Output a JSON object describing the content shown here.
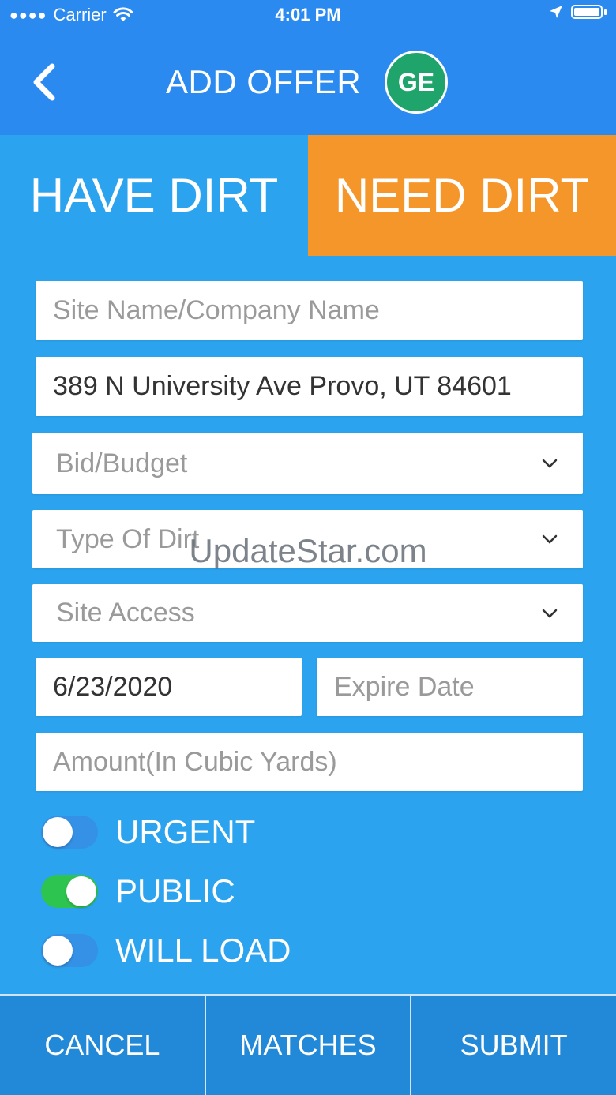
{
  "status_bar": {
    "carrier": "Carrier",
    "time": "4:01 PM"
  },
  "header": {
    "title": "ADD OFFER",
    "avatar_initials": "GE"
  },
  "tabs": [
    {
      "label": "HAVE DIRT",
      "selected": false
    },
    {
      "label": "NEED DIRT",
      "selected": true
    }
  ],
  "form": {
    "site_name": {
      "value": "",
      "placeholder": "Site Name/Company Name"
    },
    "address": {
      "value": "389 N University Ave Provo, UT 84601",
      "placeholder": ""
    },
    "bid_budget": {
      "placeholder": "Bid/Budget"
    },
    "dirt_type": {
      "placeholder": "Type Of Dirt"
    },
    "site_access": {
      "placeholder": "Site Access"
    },
    "start_date": {
      "value": "6/23/2020",
      "placeholder": ""
    },
    "expire_date": {
      "value": "",
      "placeholder": "Expire Date"
    },
    "amount": {
      "value": "",
      "placeholder": "Amount(In Cubic Yards)"
    }
  },
  "toggles": [
    {
      "label": "URGENT",
      "on": false
    },
    {
      "label": "PUBLIC",
      "on": true
    },
    {
      "label": "WILL LOAD",
      "on": false
    }
  ],
  "bottom_bar": {
    "cancel": "CANCEL",
    "matches": "MATCHES",
    "submit": "SUBMIT"
  },
  "watermark": "UpdateStar.com",
  "colors": {
    "header": "#2B8AF0",
    "background": "#2BA3EE",
    "selected_tab": "#F5962A",
    "avatar": "#1FA56B",
    "toggle_on": "#2DC44F",
    "bottom_bar": "#2288D8"
  }
}
